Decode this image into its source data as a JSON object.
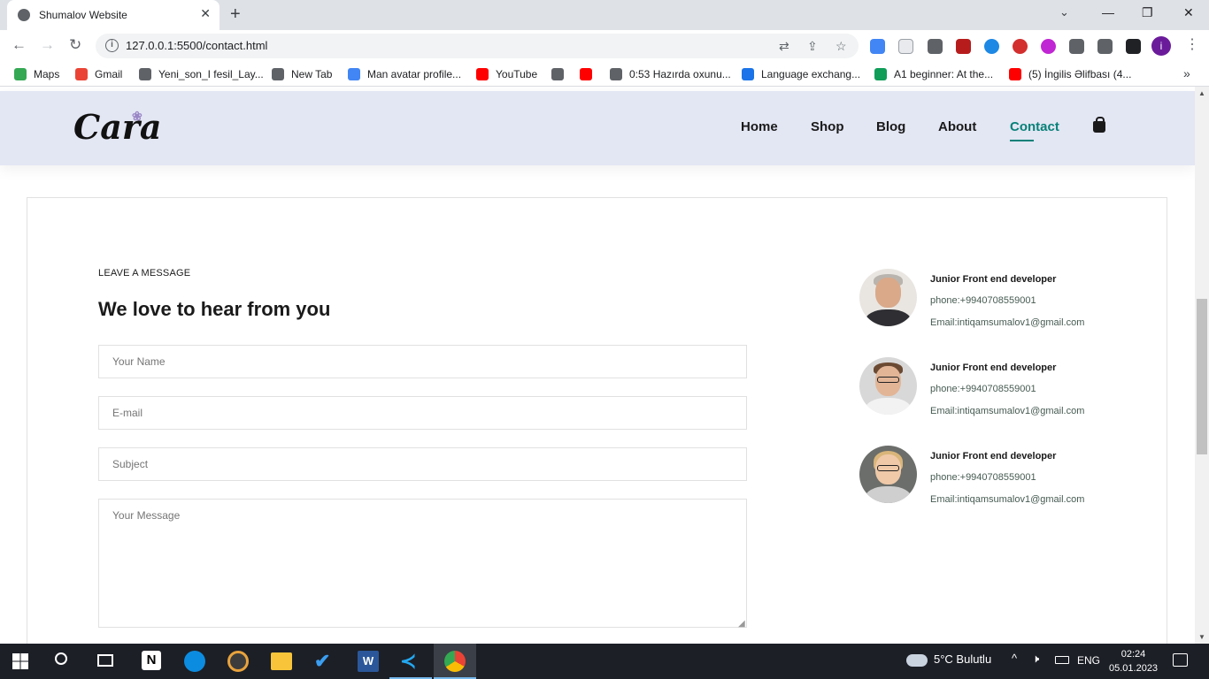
{
  "browser": {
    "tab_title": "Shumalov Website",
    "url": "127.0.0.1:5500/contact.html",
    "profile_initial": "i",
    "bookmarks": [
      {
        "label": "Maps",
        "color": "#34a853"
      },
      {
        "label": "Gmail",
        "color": "#ea4335"
      },
      {
        "label": "Yeni_son_I fesil_Lay...",
        "color": "#5f6368"
      },
      {
        "label": "New Tab",
        "color": "#5f6368"
      },
      {
        "label": "Man avatar profile...",
        "color": "#4285f4"
      },
      {
        "label": "YouTube",
        "color": "#ff0000"
      },
      {
        "label": "",
        "color": "#5f6368"
      },
      {
        "label": "",
        "color": "#ff0000"
      },
      {
        "label": "0:53 Hazırda oxunu...",
        "color": "#5f6368"
      },
      {
        "label": "Language exchang...",
        "color": "#1a73e8"
      },
      {
        "label": "A1 beginner: At the...",
        "color": "#0f9d58"
      },
      {
        "label": "(5) İngilis Əlifbası (4...",
        "color": "#ff0000"
      }
    ]
  },
  "header": {
    "logo": "Cara",
    "nav": [
      "Home",
      "Shop",
      "Blog",
      "About",
      "Contact"
    ],
    "active_nav": "Contact",
    "accent_color": "#088178"
  },
  "form": {
    "eyebrow": "LEAVE A MESSAGE",
    "heading": "We love to hear from you",
    "name_placeholder": "Your Name",
    "email_placeholder": "E-mail",
    "subject_placeholder": "Subject",
    "message_placeholder": "Your Message"
  },
  "people": [
    {
      "title": "Junior Front end developer",
      "phone": "phone:+9940708559001",
      "email": "Email:intiqamsumalov1@gmail.com",
      "avatar": "older-man-avatar"
    },
    {
      "title": "Junior Front end developer",
      "phone": "phone:+9940708559001",
      "email": "Email:intiqamsumalov1@gmail.com",
      "avatar": "man-with-glasses-avatar"
    },
    {
      "title": "Junior Front end developer",
      "phone": "phone:+9940708559001",
      "email": "Email:intiqamsumalov1@gmail.com",
      "avatar": "woman-with-glasses-avatar"
    }
  ],
  "taskbar": {
    "weather": "5°C Bulutlu",
    "language": "ENG",
    "time": "02:24",
    "date": "05.01.2023"
  }
}
